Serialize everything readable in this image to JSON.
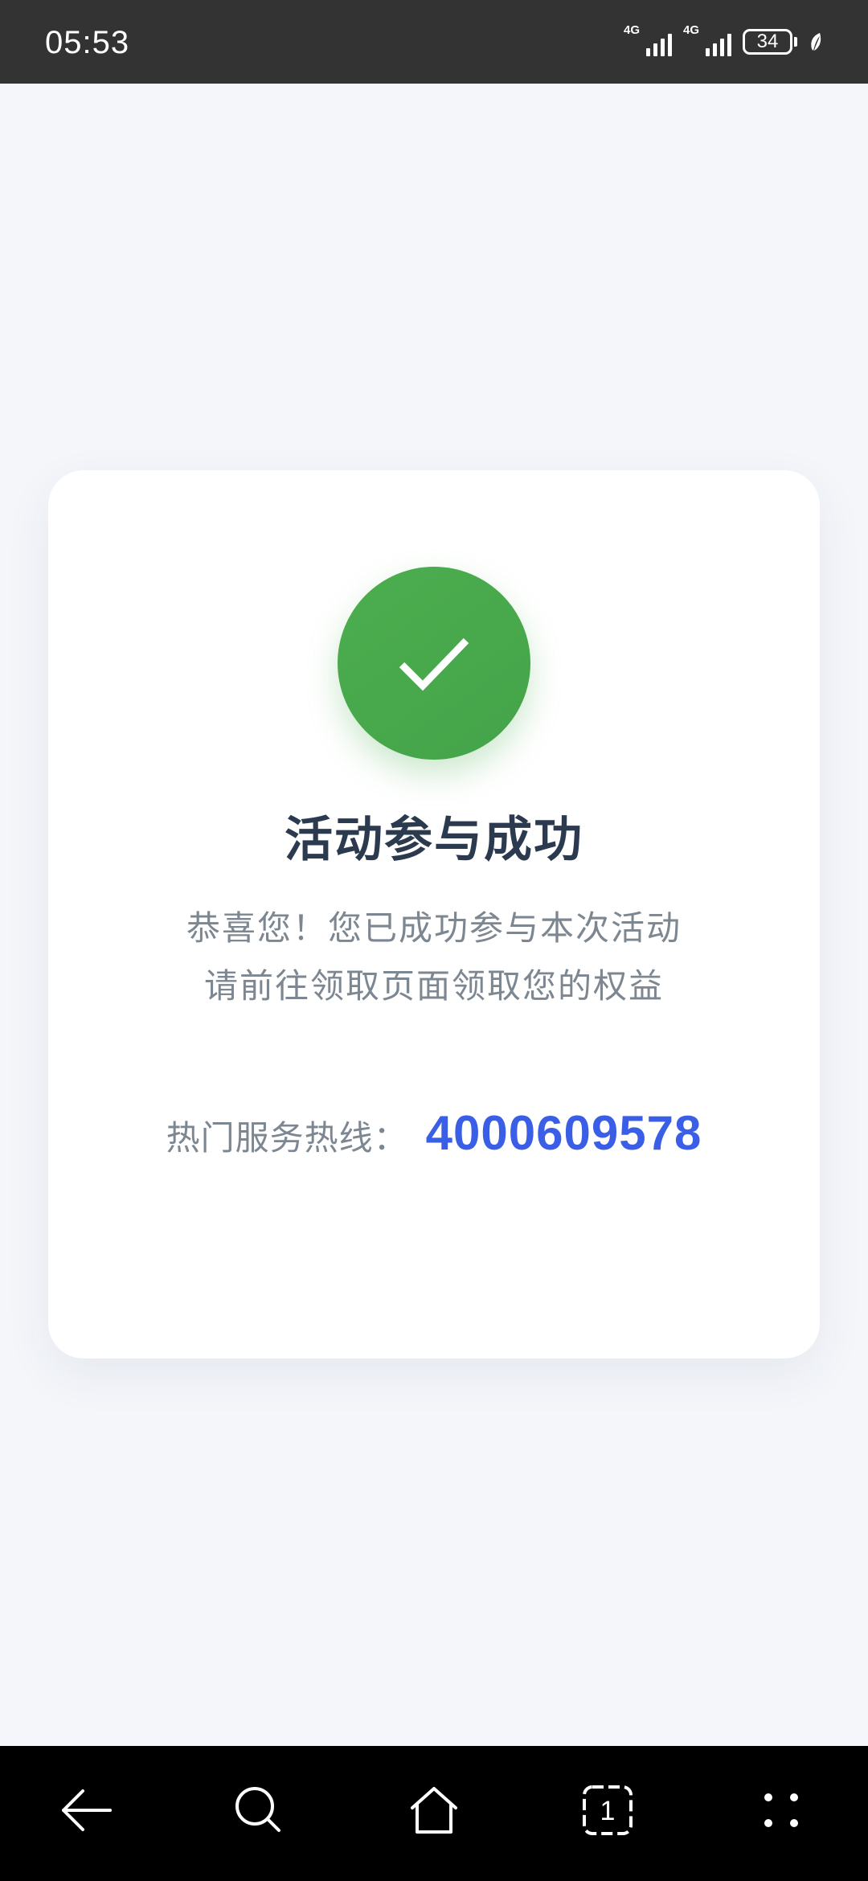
{
  "status_bar": {
    "time": "05:53",
    "network_1": "4G",
    "network_2": "4G",
    "battery_level": "34",
    "icons": [
      "signal-icon",
      "signal-icon",
      "battery-icon",
      "leaf-icon"
    ]
  },
  "result": {
    "icon": "checkmark-icon",
    "title": "活动参与成功",
    "message_line1": "恭喜您！您已成功参与本次活动",
    "message_line2": "请前往领取页面领取您的权益",
    "hotline_label": "热门服务热线：",
    "hotline_number": "4000609578"
  },
  "nav_bar": {
    "buttons": [
      "back-icon",
      "search-icon",
      "home-icon",
      "tabs-icon",
      "menu-icon"
    ],
    "tabs_count": "1"
  },
  "colors": {
    "success": "#4cae4f",
    "accent": "#3a5ee6",
    "title": "#2b3a4e",
    "background": "#f4f6fa"
  }
}
